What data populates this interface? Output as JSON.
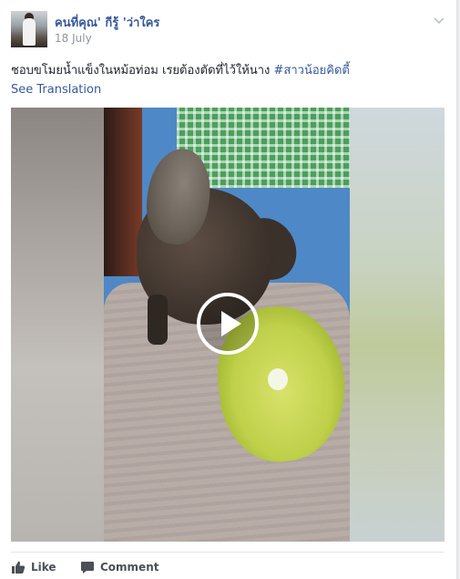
{
  "post": {
    "author": "คนที่คุณ' กีรู้ 'ว่าใคร",
    "date": "18 July",
    "text": "ชอบขโมยน้ำแข็งในหม้อท่อม เรยต้องตัดที่ไว้ให้นาง",
    "hashtag": "#สาวน้อยคิดตี้",
    "see_translation": "See Translation"
  },
  "video": {
    "play_icon": "play-icon"
  },
  "actions": {
    "like_label": "Like",
    "comment_label": "Comment"
  },
  "colors": {
    "link": "#365899",
    "meta": "#90949c",
    "text": "#1d2129",
    "action": "#4b4f56"
  }
}
